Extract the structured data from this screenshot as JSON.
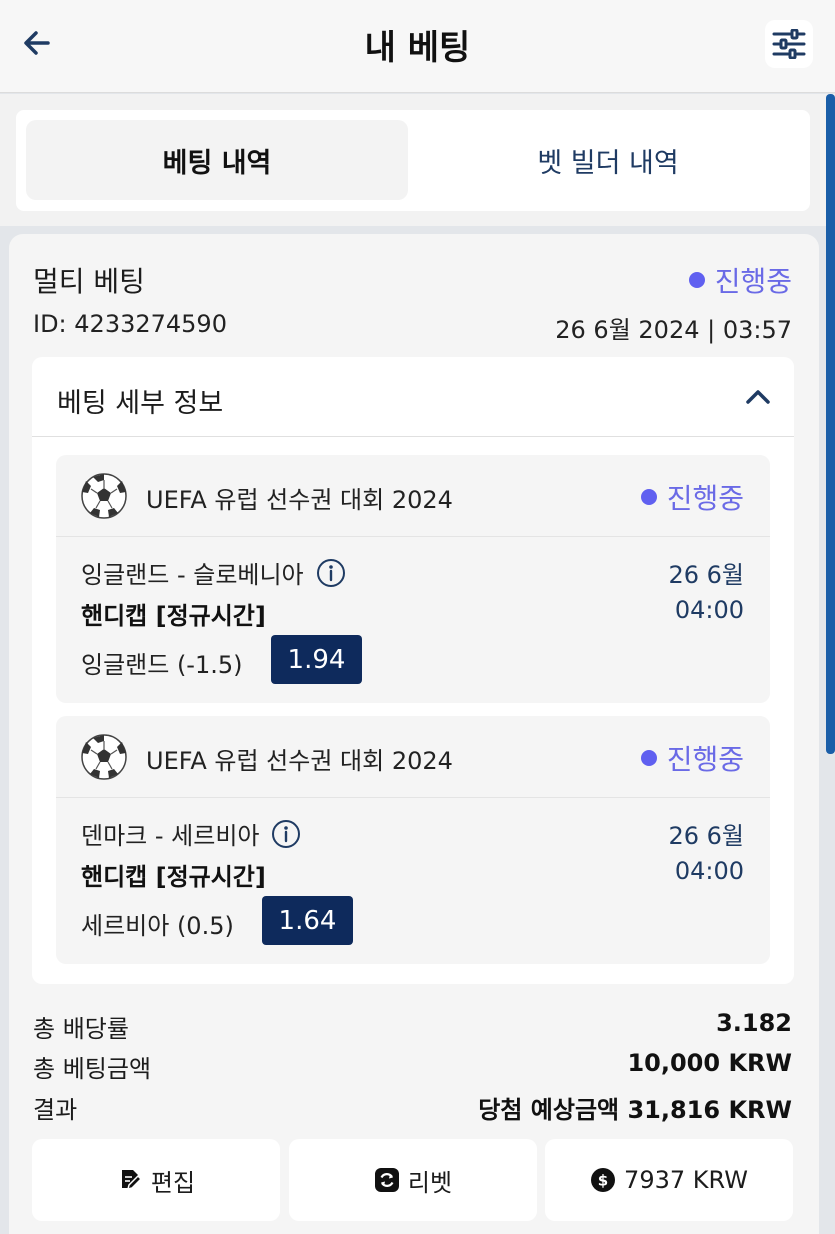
{
  "header": {
    "title": "내 베팅",
    "back_icon": "arrow-left-icon",
    "filter_icon": "sliders-icon"
  },
  "tabs": {
    "bet_history": "베팅 내역",
    "bet_builder_history": "벳 빌더 내역",
    "active": "bet_history"
  },
  "bet": {
    "type": "멀티 베팅",
    "status": "진행중",
    "status_color": "#6060f0",
    "id": "ID: 4233274590",
    "datetime": "26 6월 2024 | 03:57",
    "details_title": "베팅 세부 정보",
    "matches": [
      {
        "league": "UEFA 유럽 선수권 대회 2024",
        "status": "진행중",
        "teams": "잉글랜드 - 슬로베니아",
        "date": "26 6월",
        "market": "핸디캡 [정규시간]",
        "time": "04:00",
        "selection": "잉글랜드 (-1.5)",
        "odds": "1.94"
      },
      {
        "league": "UEFA 유럽 선수권 대회 2024",
        "status": "진행중",
        "teams": "덴마크 - 세르비아",
        "date": "26 6월",
        "market": "핸디캡 [정규시간]",
        "time": "04:00",
        "selection": "세르비아 (0.5)",
        "odds": "1.64"
      }
    ],
    "summary": {
      "total_odds_label": "총 배당률",
      "total_odds_value": "3.182",
      "total_stake_label": "총 베팅금액",
      "total_stake_value": "10,000 KRW",
      "result_label": "결과",
      "result_value": "당첨 예상금액 31,816 KRW"
    },
    "actions": {
      "edit": "편집",
      "rebet": "리벳",
      "cashout": "7937 KRW"
    }
  },
  "colors": {
    "odds_bg": "#0e2a5c",
    "accent_blue": "#1f3b63",
    "scrollbar": "#1a5ea8"
  }
}
